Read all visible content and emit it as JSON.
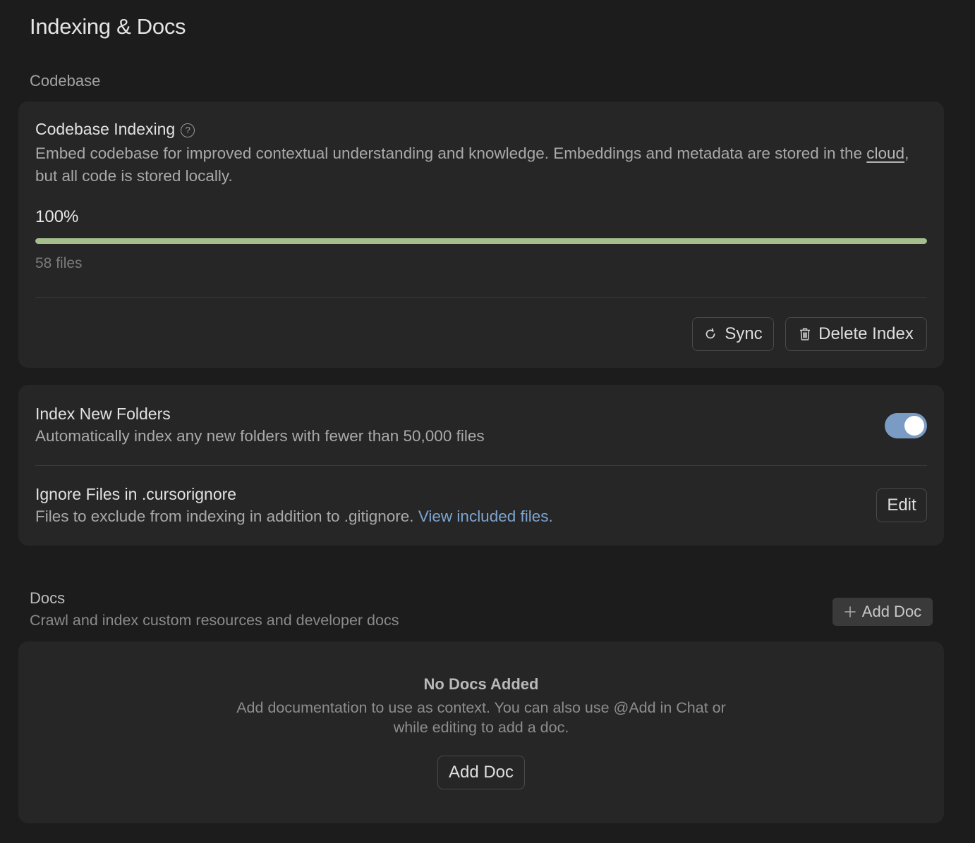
{
  "page": {
    "title": "Indexing & Docs"
  },
  "codebase": {
    "section_label": "Codebase",
    "indexing": {
      "title": "Codebase Indexing",
      "help_glyph": "?",
      "desc_before_link": "Embed codebase for improved contextual understanding and knowledge. Embeddings and metadata are stored in the ",
      "link_text": "cloud",
      "desc_after_link": ", but all code is stored locally.",
      "progress_label": "100%",
      "progress_fraction": 1.0,
      "progress_color": "#a5be8c",
      "files_count": "58 files",
      "sync_label": "Sync",
      "sync_icon": "refresh-icon",
      "delete_label": "Delete Index",
      "delete_icon": "trash-icon"
    },
    "index_new_folders": {
      "title": "Index New Folders",
      "desc": "Automatically index any new folders with fewer than 50,000 files",
      "enabled": true,
      "toggle_color": "#7a9cc4"
    },
    "ignore_files": {
      "title": "Ignore Files in .cursorignore",
      "desc": "Files to exclude from indexing in addition to .gitignore. ",
      "link_text": "View included files.",
      "link_color": "#7ea4d1",
      "edit_label": "Edit"
    }
  },
  "docs": {
    "title": "Docs",
    "desc": "Crawl and index custom resources and developer docs",
    "add_doc_top_label": "Add Doc",
    "add_doc_icon": "plus-icon",
    "empty": {
      "title": "No Docs Added",
      "desc": "Add documentation to use as context. You can also use @Add in Chat or while editing to add a doc.",
      "button_label": "Add Doc"
    }
  }
}
